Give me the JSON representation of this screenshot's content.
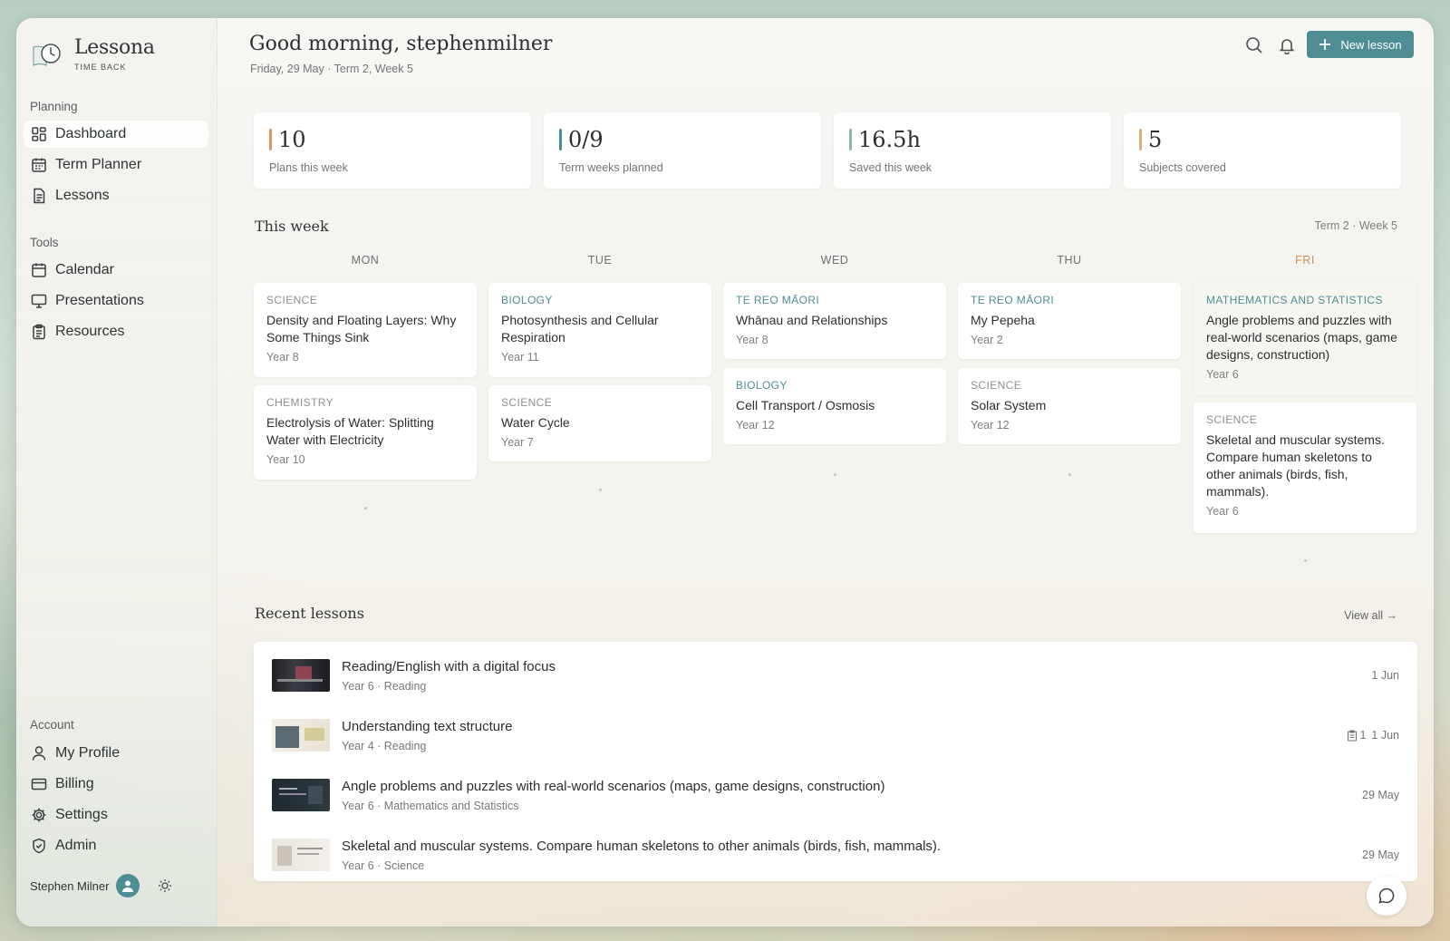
{
  "brand": {
    "name": "Lessona",
    "tagline": "TIME BACK"
  },
  "nav": {
    "planning_title": "Planning",
    "planning": [
      {
        "label": "Dashboard",
        "icon": "grid-icon"
      },
      {
        "label": "Term Planner",
        "icon": "calendar-grid-icon"
      },
      {
        "label": "Lessons",
        "icon": "document-icon"
      }
    ],
    "tools_title": "Tools",
    "tools": [
      {
        "label": "Calendar",
        "icon": "calendar-icon"
      },
      {
        "label": "Presentations",
        "icon": "monitor-icon"
      },
      {
        "label": "Resources",
        "icon": "clipboard-icon"
      }
    ],
    "account_title": "Account",
    "account": [
      {
        "label": "My Profile",
        "icon": "user-icon"
      },
      {
        "label": "Billing",
        "icon": "card-icon"
      },
      {
        "label": "Settings",
        "icon": "gear-icon"
      },
      {
        "label": "Admin",
        "icon": "shield-icon"
      }
    ]
  },
  "user": {
    "name": "Stephen Milner"
  },
  "header": {
    "greeting": "Good morning, stephenmilner",
    "subdate": "Friday, 29 May · Term 2, Week 5",
    "new_button": "New lesson"
  },
  "stats": [
    {
      "value": "10",
      "label": "Plans this week",
      "color": "#d89a62"
    },
    {
      "value": "0/9",
      "label": "Term weeks planned",
      "color": "#4f8d95"
    },
    {
      "value": "16.5h",
      "label": "Saved this week",
      "color": "#8fb6a4"
    },
    {
      "value": "5",
      "label": "Subjects covered",
      "color": "#d8b080"
    }
  ],
  "week": {
    "title": "This week",
    "meta": "Term 2 · Week 5",
    "days": [
      {
        "label": "MON",
        "cards": [
          {
            "subject": "SCIENCE",
            "title": "Density and Floating Layers: Why Some Things Sink",
            "year": "Year 8"
          },
          {
            "subject": "CHEMISTRY",
            "title": "Electrolysis of Water: Splitting Water with Electricity",
            "year": "Year 10"
          }
        ]
      },
      {
        "label": "TUE",
        "cards": [
          {
            "subject": "BIOLOGY",
            "title": "Photosynthesis and Cellular Respiration",
            "year": "Year 11"
          },
          {
            "subject": "SCIENCE",
            "title": "Water Cycle",
            "year": "Year 7"
          }
        ]
      },
      {
        "label": "WED",
        "cards": [
          {
            "subject": "TE REO MĀORI",
            "title": "Whānau and Relationships",
            "year": "Year 8"
          },
          {
            "subject": "BIOLOGY",
            "title": "Cell Transport / Osmosis",
            "year": "Year 12"
          }
        ]
      },
      {
        "label": "THU",
        "cards": [
          {
            "subject": "TE REO MĀORI",
            "title": "My Pepeha",
            "year": "Year 2"
          },
          {
            "subject": "SCIENCE",
            "title": "Solar System",
            "year": "Year 12"
          }
        ]
      },
      {
        "label": "FRI",
        "cards": [
          {
            "subject": "MATHEMATICS AND STATISTICS",
            "title": "Angle problems and puzzles with real-world scenarios (maps, game designs, construction)",
            "year": "Year 6"
          },
          {
            "subject": "SCIENCE",
            "title": "Skeletal and muscular systems. Compare human skeletons to other animals (birds, fish, mammals).",
            "year": "Year 6"
          }
        ]
      }
    ]
  },
  "recent": {
    "title": "Recent lessons",
    "view_all": "View all →",
    "items": [
      {
        "title": "Reading/English with a digital focus",
        "sub": "Year 6 · Reading",
        "date": "1 Jun",
        "badge": ""
      },
      {
        "title": "Understanding text structure",
        "sub": "Year 4 · Reading",
        "date": "1 Jun",
        "badge": "1"
      },
      {
        "title": "Angle problems and puzzles with real-world scenarios (maps, game designs, construction)",
        "sub": "Year 6 · Mathematics and Statistics",
        "date": "29 May",
        "badge": ""
      },
      {
        "title": "Skeletal and muscular systems. Compare human skeletons to other animals (birds, fish, mammals).",
        "sub": "Year 6 · Science",
        "date": "29 May",
        "badge": ""
      }
    ]
  }
}
